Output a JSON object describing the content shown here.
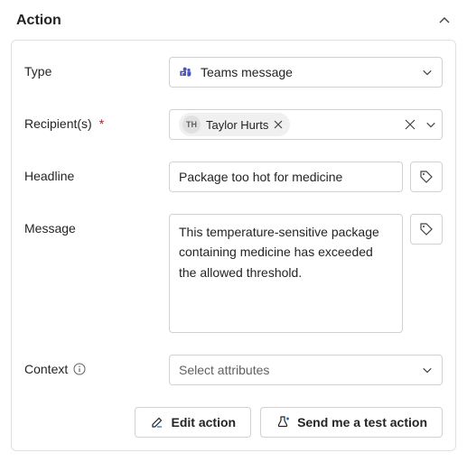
{
  "header": {
    "title": "Action"
  },
  "fields": {
    "type": {
      "label": "Type",
      "value": "Teams message"
    },
    "recipients": {
      "label": "Recipient(s)",
      "required_mark": "*",
      "chip": {
        "initials": "TH",
        "name": "Taylor Hurts"
      }
    },
    "headline": {
      "label": "Headline",
      "value": "Package too hot for medicine"
    },
    "message": {
      "label": "Message",
      "value": "This temperature-sensitive package containing medicine has exceeded the allowed threshold."
    },
    "context": {
      "label": "Context",
      "placeholder": "Select attributes"
    }
  },
  "buttons": {
    "edit": "Edit action",
    "test": "Send me a test action"
  }
}
